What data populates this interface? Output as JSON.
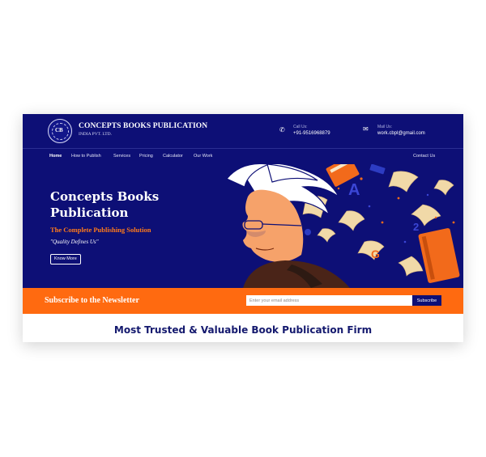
{
  "header": {
    "brand_name": "CONCEPTS BOOKS PUBLICATION",
    "brand_subtitle": "INDIA PVT. LTD.",
    "call_label": "Call Us:",
    "call_value": "+91-9516968879",
    "mail_label": "Mail Us:",
    "mail_value": "work.cbpl@gmail.com",
    "call_icon": "phone-icon",
    "mail_icon": "envelope-icon"
  },
  "nav": {
    "items": [
      {
        "label": "Home",
        "active": true
      },
      {
        "label": "How to Publish"
      },
      {
        "label": "Services"
      },
      {
        "label": "Pricing"
      },
      {
        "label": "Calculator"
      },
      {
        "label": "Our Work"
      }
    ],
    "contact_label": "Contact Us"
  },
  "hero": {
    "title": "Concepts Books Publication",
    "tagline": "The Complete Publishing Solution",
    "quote": "\"Quality Defines Us\"",
    "button_label": "Know More",
    "art_letters": [
      "A",
      "G",
      "2"
    ]
  },
  "newsletter": {
    "title": "Subscribe to the Newsletter",
    "placeholder": "Enter your email address",
    "button_label": "Subscribe"
  },
  "section": {
    "title": "Most Trusted & Valuable Book Publication Firm"
  },
  "colors": {
    "navy": "#0d0f76",
    "orange": "#ff6a10",
    "heading": "#14196e"
  }
}
